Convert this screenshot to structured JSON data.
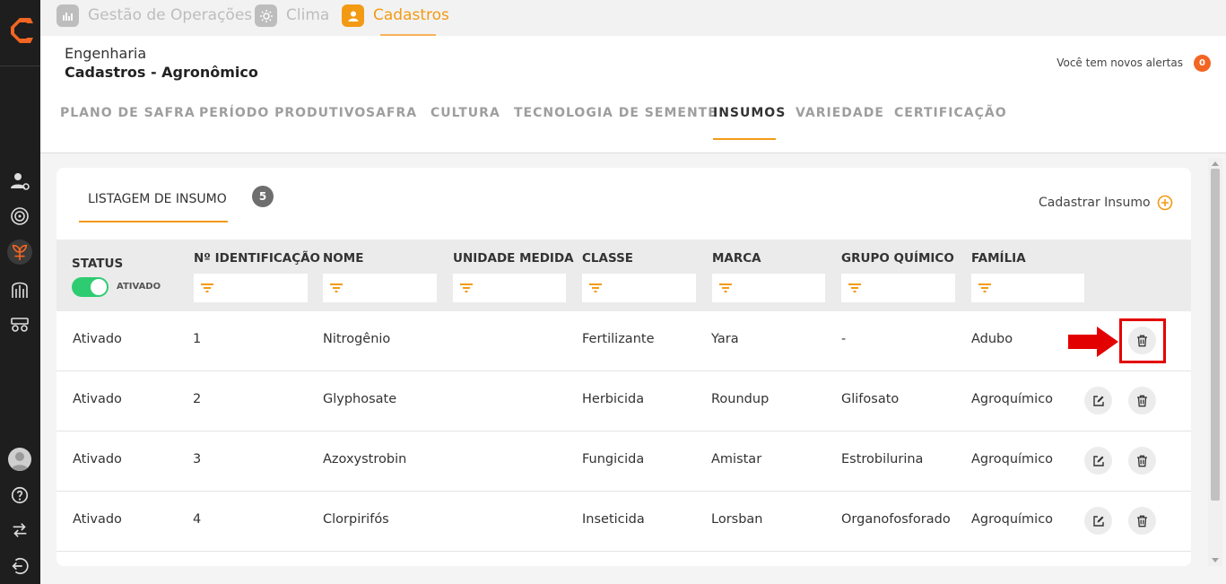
{
  "topbar": {
    "tabs": [
      {
        "label": "Gestão de Operações",
        "icon": "chart-icon",
        "active": false
      },
      {
        "label": "Clima",
        "icon": "sun-icon",
        "active": false
      },
      {
        "label": "Cadastros",
        "icon": "user-icon",
        "active": true
      }
    ]
  },
  "header": {
    "section": "Engenharia",
    "title": "Cadastros - Agronômico",
    "alerts_text": "Você tem novos alertas",
    "alerts_count": "0"
  },
  "nav": {
    "tabs": [
      "PLANO DE SAFRA",
      "PERÍODO PRODUTIVO",
      "SAFRA",
      "CULTURA",
      "TECNOLOGIA DE SEMENTE",
      "INSUMOS",
      "VARIEDADE",
      "CERTIFICAÇÃO"
    ],
    "active": "INSUMOS"
  },
  "listing": {
    "tab_label": "LISTAGEM DE INSUMO",
    "count": "5",
    "add_label": "Cadastrar Insumo"
  },
  "table": {
    "headers": [
      "STATUS",
      "Nº IDENTIFICAÇÃO",
      "NOME",
      "UNIDADE MEDIDA",
      "CLASSE",
      "MARCA",
      "GRUPO QUÍMICO",
      "FAMÍLIA"
    ],
    "status_toggle_label": "ATIVADO",
    "rows": [
      {
        "status": "Ativado",
        "id": "1",
        "nome": "Nitrogênio",
        "unidade": "",
        "classe": "Fertilizante",
        "marca": "Yara",
        "grupo": "-",
        "familia": "Adubo"
      },
      {
        "status": "Ativado",
        "id": "2",
        "nome": "Glyphosate",
        "unidade": "",
        "classe": "Herbicida",
        "marca": "Roundup",
        "grupo": "Glifosato",
        "familia": "Agroquímico"
      },
      {
        "status": "Ativado",
        "id": "3",
        "nome": "Azoxystrobin",
        "unidade": "",
        "classe": "Fungicida",
        "marca": "Amistar",
        "grupo": "Estrobilurina",
        "familia": "Agroquímico"
      },
      {
        "status": "Ativado",
        "id": "4",
        "nome": "Clorpirifós",
        "unidade": "",
        "classe": "Inseticida",
        "marca": "Lorsban",
        "grupo": "Organofosforado",
        "familia": "Agroquímico"
      }
    ]
  },
  "colors": {
    "accent": "#f39a14",
    "toggle_on": "#2ecc71",
    "highlight": "#e30000",
    "sidebar": "#1e1e1e"
  }
}
